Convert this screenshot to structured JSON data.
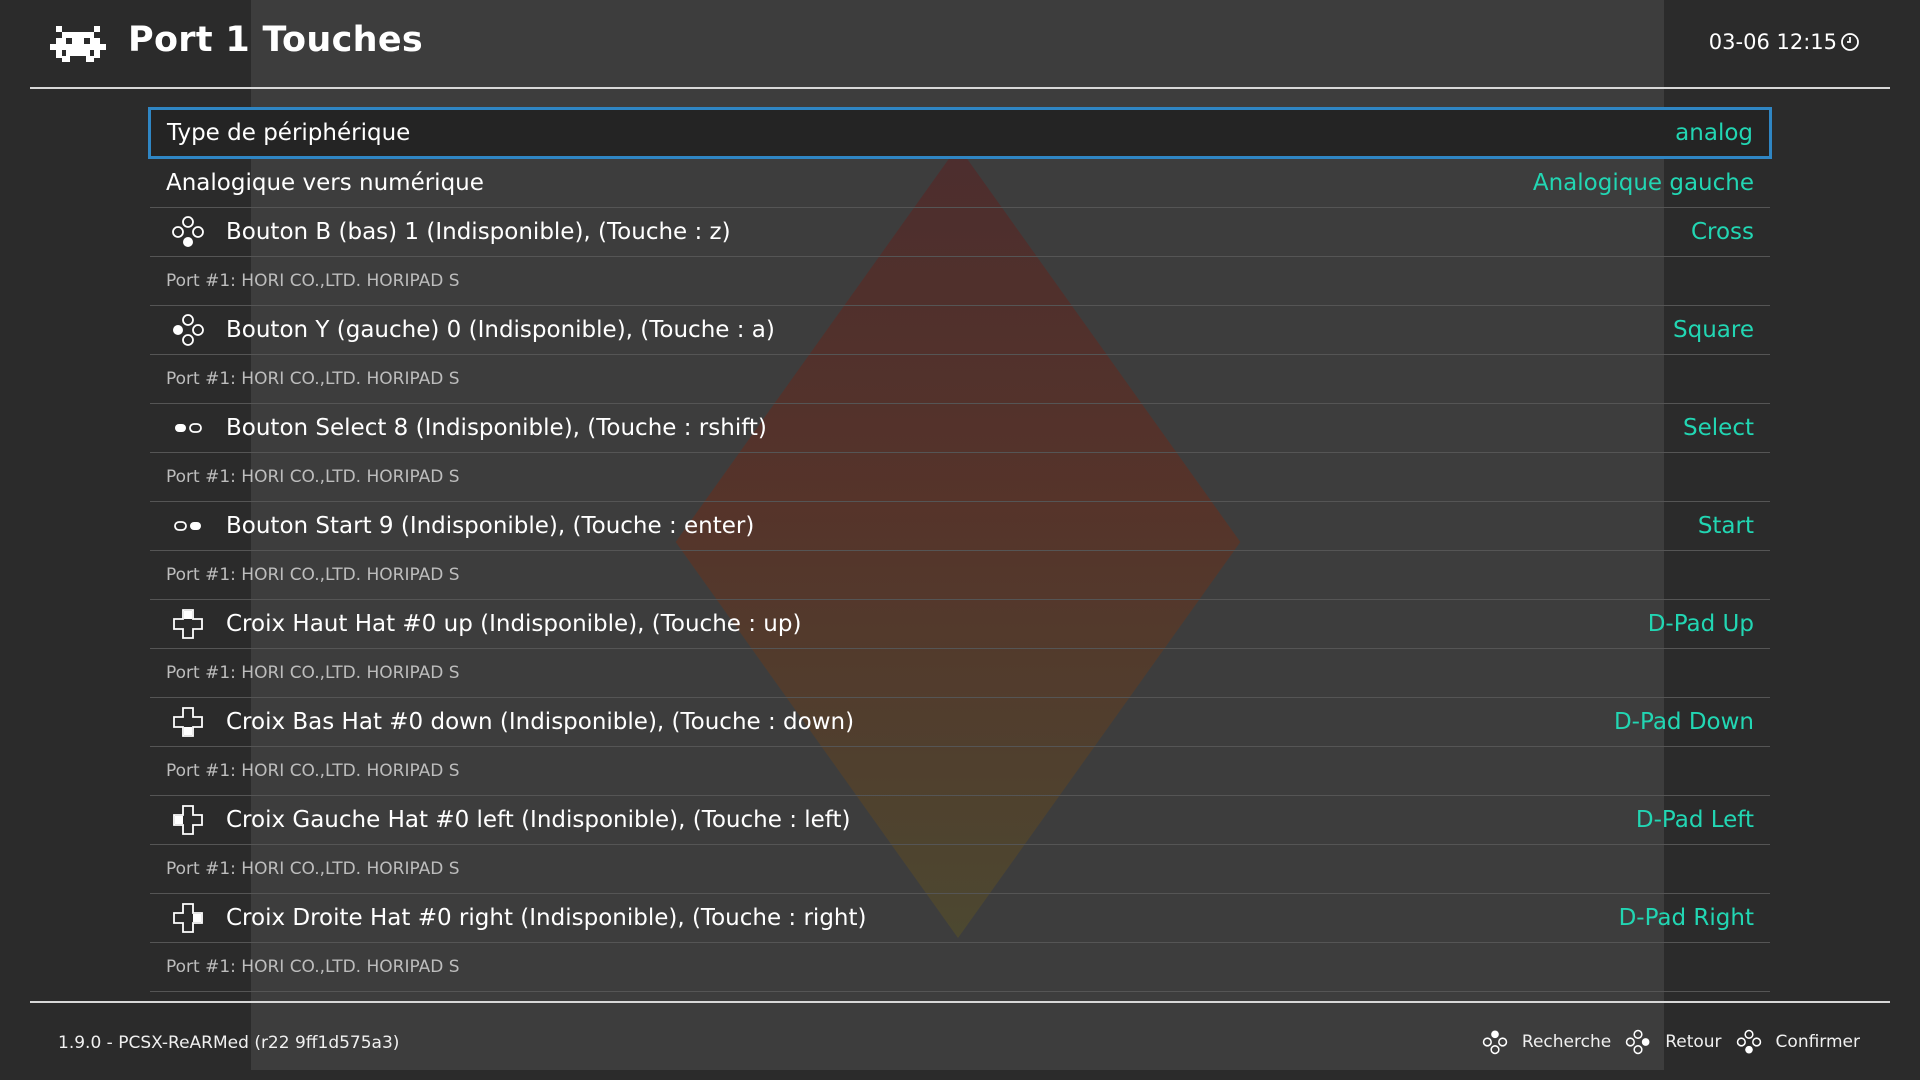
{
  "header": {
    "title": "Port 1 Touches",
    "clock": "03-06 12:15",
    "logo_icon": "retroarch-invader-icon",
    "clock_icon": "clock-icon"
  },
  "colors": {
    "accent": "#22d6b3",
    "selection_border": "#2f86c4"
  },
  "settings": [
    {
      "label": "Type de périphérique",
      "value": "analog"
    },
    {
      "label": "Analogique vers numérique",
      "value": "Analogique gauche"
    }
  ],
  "bindings": [
    {
      "label": "Bouton B (bas) 1 (Indisponible), (Touche : z)",
      "value": "Cross",
      "sub": "Port #1: HORI CO.,LTD. HORIPAD S",
      "icon": "face-button-bottom-icon"
    },
    {
      "label": "Bouton Y (gauche) 0 (Indisponible), (Touche : a)",
      "value": "Square",
      "sub": "Port #1: HORI CO.,LTD. HORIPAD S",
      "icon": "face-button-left-icon"
    },
    {
      "label": "Bouton Select 8 (Indisponible), (Touche : rshift)",
      "value": "Select",
      "sub": "Port #1: HORI CO.,LTD. HORIPAD S",
      "icon": "select-button-icon"
    },
    {
      "label": "Bouton Start 9 (Indisponible), (Touche : enter)",
      "value": "Start",
      "sub": "Port #1: HORI CO.,LTD. HORIPAD S",
      "icon": "start-button-icon"
    },
    {
      "label": "Croix Haut Hat #0 up (Indisponible), (Touche : up)",
      "value": "D-Pad Up",
      "sub": "Port #1: HORI CO.,LTD. HORIPAD S",
      "icon": "dpad-up-icon"
    },
    {
      "label": "Croix Bas Hat #0 down (Indisponible), (Touche : down)",
      "value": "D-Pad Down",
      "sub": "Port #1: HORI CO.,LTD. HORIPAD S",
      "icon": "dpad-down-icon"
    },
    {
      "label": "Croix Gauche Hat #0 left (Indisponible), (Touche : left)",
      "value": "D-Pad Left",
      "sub": "Port #1: HORI CO.,LTD. HORIPAD S",
      "icon": "dpad-left-icon"
    },
    {
      "label": "Croix Droite Hat #0 right (Indisponible), (Touche : right)",
      "value": "D-Pad Right",
      "sub": "Port #1: HORI CO.,LTD. HORIPAD S",
      "icon": "dpad-right-icon"
    }
  ],
  "footer": {
    "version": "1.9.0 - PCSX-ReARMed (r22 9ff1d575a3)",
    "hints": [
      {
        "label": "Recherche",
        "icon": "face-button-top-icon"
      },
      {
        "label": "Retour",
        "icon": "face-button-right-icon"
      },
      {
        "label": "Confirmer",
        "icon": "face-button-bottom-icon"
      }
    ]
  }
}
